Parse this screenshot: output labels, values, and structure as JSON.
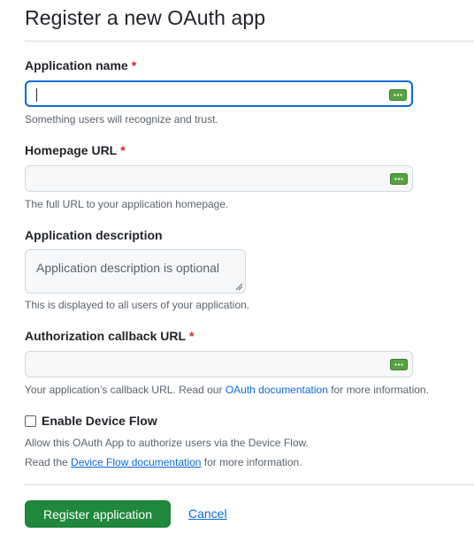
{
  "page_title": "Register a new OAuth app",
  "required_marker": "*",
  "app_name": {
    "label": "Application name",
    "value": "",
    "hint": "Something users will recognize and trust."
  },
  "homepage_url": {
    "label": "Homepage URL",
    "value": "",
    "hint": "The full URL to your application homepage."
  },
  "description": {
    "label": "Application description",
    "placeholder": "Application description is optional",
    "hint": "This is displayed to all users of your application."
  },
  "callback_url": {
    "label": "Authorization callback URL",
    "value": "",
    "hint_prefix": "Your application’s callback URL. Read our ",
    "hint_link": "OAuth documentation",
    "hint_suffix": " for more information."
  },
  "device_flow": {
    "label": "Enable Device Flow",
    "checked": false,
    "description": "Allow this OAuth App to authorize users via the Device Flow.",
    "doc_prefix": "Read the ",
    "doc_link": "Device Flow documentation",
    "doc_suffix": " for more information."
  },
  "actions": {
    "register_label": "Register application",
    "cancel_label": "Cancel"
  },
  "colors": {
    "primary_button": "#1f883d",
    "link": "#0969da",
    "focus_border": "#0969da",
    "required": "#d1242f",
    "field_icon": "#57a340"
  },
  "icons": {
    "field_icon": "keyboard-icon"
  }
}
